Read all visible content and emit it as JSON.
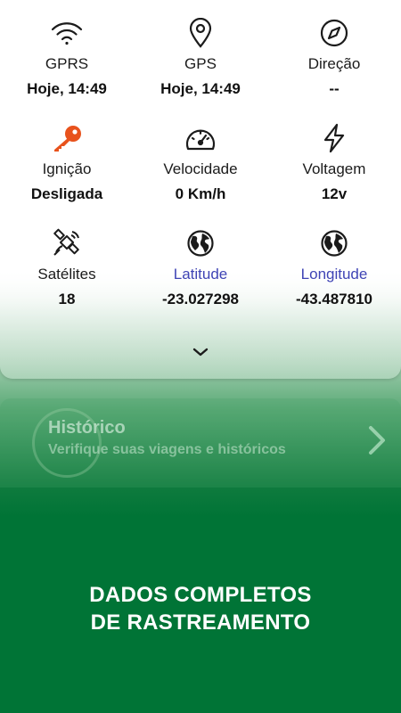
{
  "grid": [
    {
      "label": "GPRS",
      "value": "Hoje, 14:49",
      "icon": "wifi-icon"
    },
    {
      "label": "GPS",
      "value": "Hoje, 14:49",
      "icon": "location-pin-icon"
    },
    {
      "label": "Direção",
      "value": "--",
      "icon": "compass-icon"
    },
    {
      "label": "Ignição",
      "value": "Desligada",
      "icon": "key-icon",
      "icon_color": "#e8521c"
    },
    {
      "label": "Velocidade",
      "value": "0 Km/h",
      "icon": "speedometer-icon"
    },
    {
      "label": "Voltagem",
      "value": "12v",
      "icon": "lightning-icon"
    },
    {
      "label": "Satélites",
      "value": "18",
      "icon": "satellite-icon"
    },
    {
      "label": "Latitude",
      "value": "-23.027298",
      "icon": "globe-icon",
      "label_color": "#3f44b5"
    },
    {
      "label": "Longitude",
      "value": "-43.487810",
      "icon": "globe-icon",
      "label_color": "#3f44b5"
    }
  ],
  "history": {
    "title": "Histórico",
    "subtitle": "Verifique suas viagens e históricos"
  },
  "promo": {
    "line1": "DADOS COMPLETOS",
    "line2": "DE RASTREAMENTO"
  },
  "colors": {
    "brand_green": "#007436",
    "link_blue": "#3f44b5",
    "ignition_orange": "#e8521c"
  }
}
